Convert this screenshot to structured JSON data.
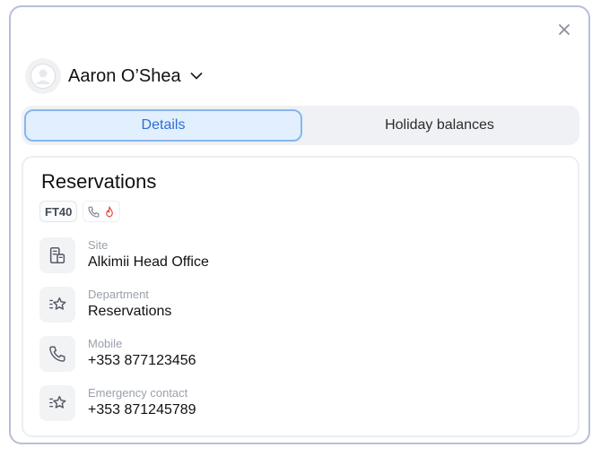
{
  "header": {
    "user_name": "Aaron O’Shea"
  },
  "tabs": [
    {
      "label": "Details",
      "active": true
    },
    {
      "label": "Holiday balances",
      "active": false
    }
  ],
  "card": {
    "title": "Reservations",
    "badge_code": "FT40",
    "badge_icons": [
      "phone-icon",
      "fire-icon"
    ],
    "rows": [
      {
        "label": "Site",
        "value": "Alkimii Head Office",
        "icon": "building-icon"
      },
      {
        "label": "Department",
        "value": "Reservations",
        "icon": "star-list-icon"
      },
      {
        "label": "Mobile",
        "value": "+353 877123456",
        "icon": "phone-icon"
      },
      {
        "label": "Emergency contact",
        "value": "+353 871245789",
        "icon": "star-list-icon"
      }
    ]
  },
  "colors": {
    "accent": "#2b6fd6",
    "tab_active_bg": "#e2efff",
    "tab_active_border": "#86b6f0",
    "fire_icon": "#e0453a",
    "border": "#b7bfd8"
  }
}
